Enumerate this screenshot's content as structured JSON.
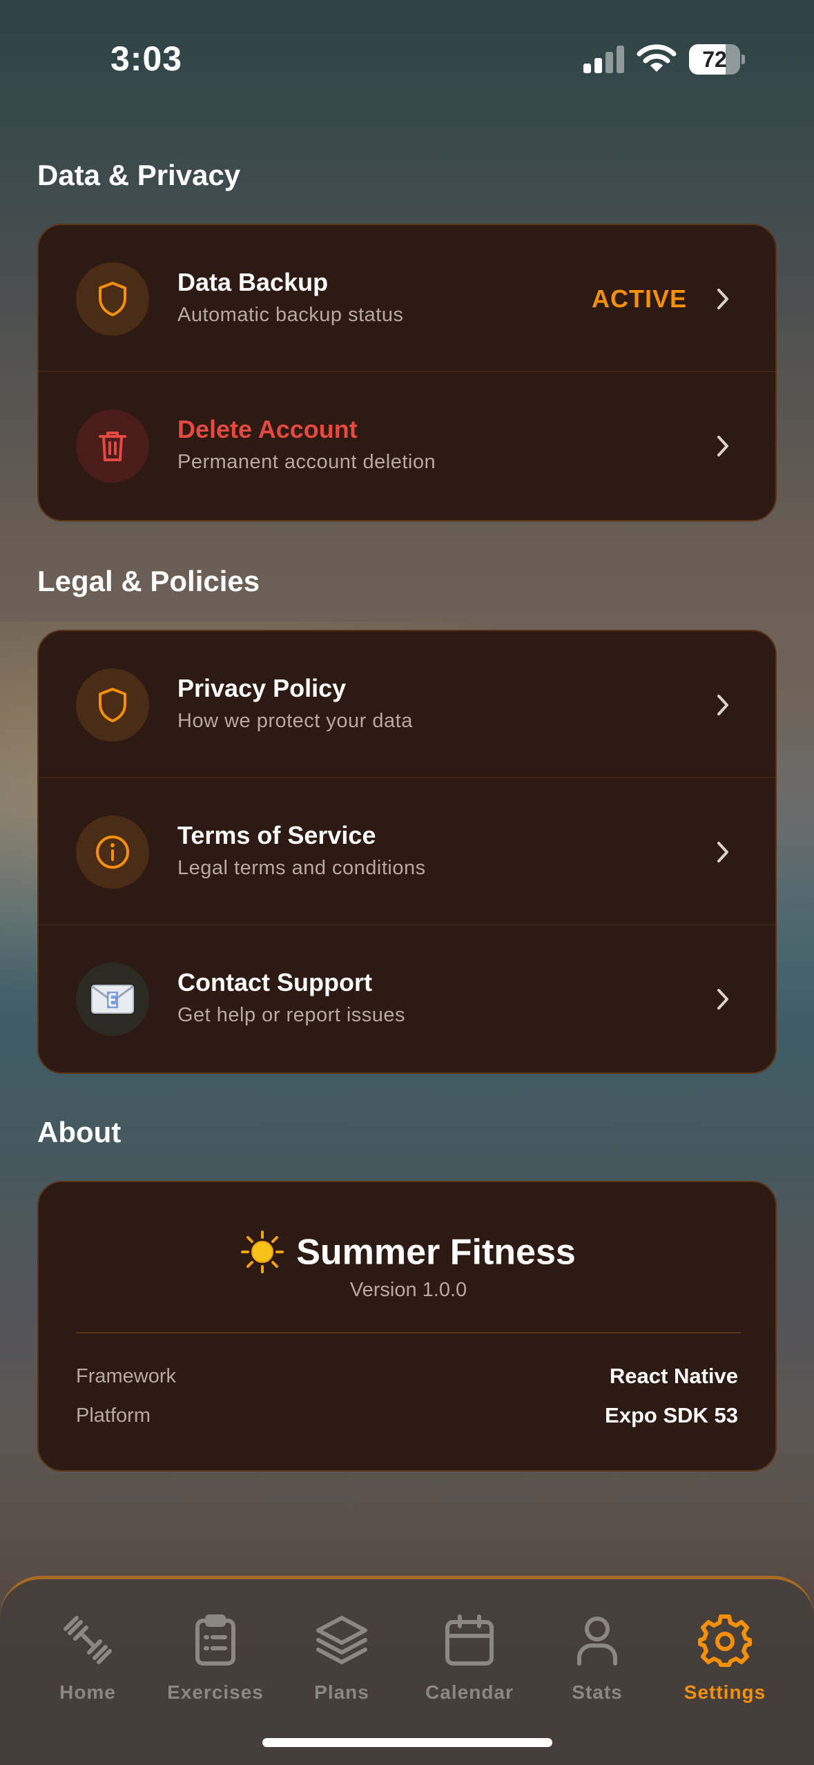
{
  "status_bar": {
    "time": "3:03",
    "battery": "72",
    "battery_level": 0.72
  },
  "sections": {
    "data_privacy": {
      "title": "Data & Privacy",
      "rows": [
        {
          "icon": "shield-icon",
          "title": "Data Backup",
          "subtitle": "Automatic backup status",
          "badge": "ACTIVE"
        },
        {
          "icon": "trash-icon",
          "title": "Delete Account",
          "subtitle": "Permanent account deletion"
        }
      ]
    },
    "legal": {
      "title": "Legal & Policies",
      "rows": [
        {
          "icon": "shield-icon",
          "title": "Privacy Policy",
          "subtitle": "How we protect your data"
        },
        {
          "icon": "info-icon",
          "title": "Terms of Service",
          "subtitle": "Legal terms and conditions"
        },
        {
          "icon": "envelope-icon",
          "title": "Contact Support",
          "subtitle": "Get help or report issues"
        }
      ]
    },
    "about": {
      "title": "About",
      "app_name": "Summer Fitness",
      "version": "Version 1.0.0",
      "framework_label": "Framework",
      "framework_value": "React Native",
      "platform_label": "Platform",
      "platform_value": "Expo SDK 53"
    }
  },
  "tabs": [
    {
      "label": "Home",
      "icon": "dumbbell-icon",
      "active": false
    },
    {
      "label": "Exercises",
      "icon": "clipboard-icon",
      "active": false
    },
    {
      "label": "Plans",
      "icon": "layers-icon",
      "active": false
    },
    {
      "label": "Calendar",
      "icon": "calendar-icon",
      "active": false
    },
    {
      "label": "Stats",
      "icon": "user-icon",
      "active": false
    },
    {
      "label": "Settings",
      "icon": "gear-icon",
      "active": true
    }
  ],
  "colors": {
    "accent": "#f5900c",
    "danger": "#e54a42",
    "card_bg": "#2d1a12",
    "card_border": "#5a3418",
    "tab_inactive": "#8b8782"
  }
}
